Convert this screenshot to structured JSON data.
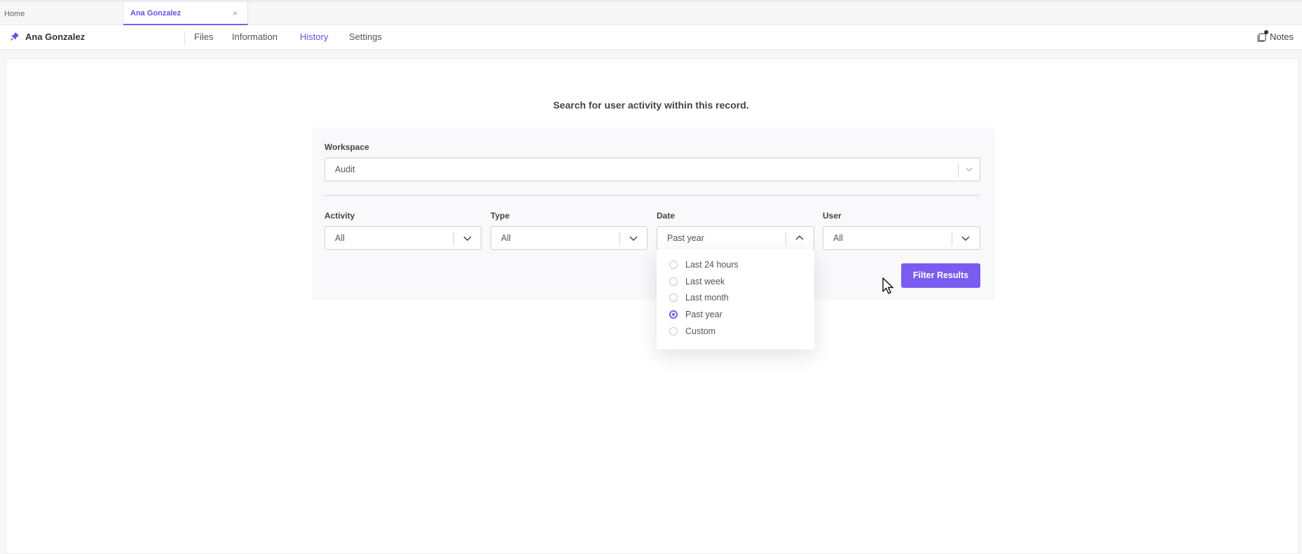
{
  "tabs": [
    {
      "label": "Home"
    },
    {
      "label": "Ana Gonzalez",
      "close": "×"
    }
  ],
  "record": {
    "name": "Ana Gonzalez",
    "nav": [
      "Files",
      "Information",
      "History",
      "Settings"
    ],
    "active_nav": "History",
    "notes_label": "Notes"
  },
  "headline": "Search for user activity within this record.",
  "workspace": {
    "label": "Workspace",
    "value": "Audit"
  },
  "filters": {
    "activity": {
      "label": "Activity",
      "value": "All"
    },
    "type": {
      "label": "Type",
      "value": "All"
    },
    "date": {
      "label": "Date",
      "value": "Past year",
      "open": true
    },
    "user": {
      "label": "User",
      "value": "All"
    }
  },
  "date_options": [
    {
      "label": "Last 24 hours",
      "selected": false
    },
    {
      "label": "Last week",
      "selected": false
    },
    {
      "label": "Last month",
      "selected": false
    },
    {
      "label": "Past year",
      "selected": true
    },
    {
      "label": "Custom",
      "selected": false
    }
  ],
  "filter_button": "Filter Results",
  "colors": {
    "accent": "#7a5cf0"
  }
}
